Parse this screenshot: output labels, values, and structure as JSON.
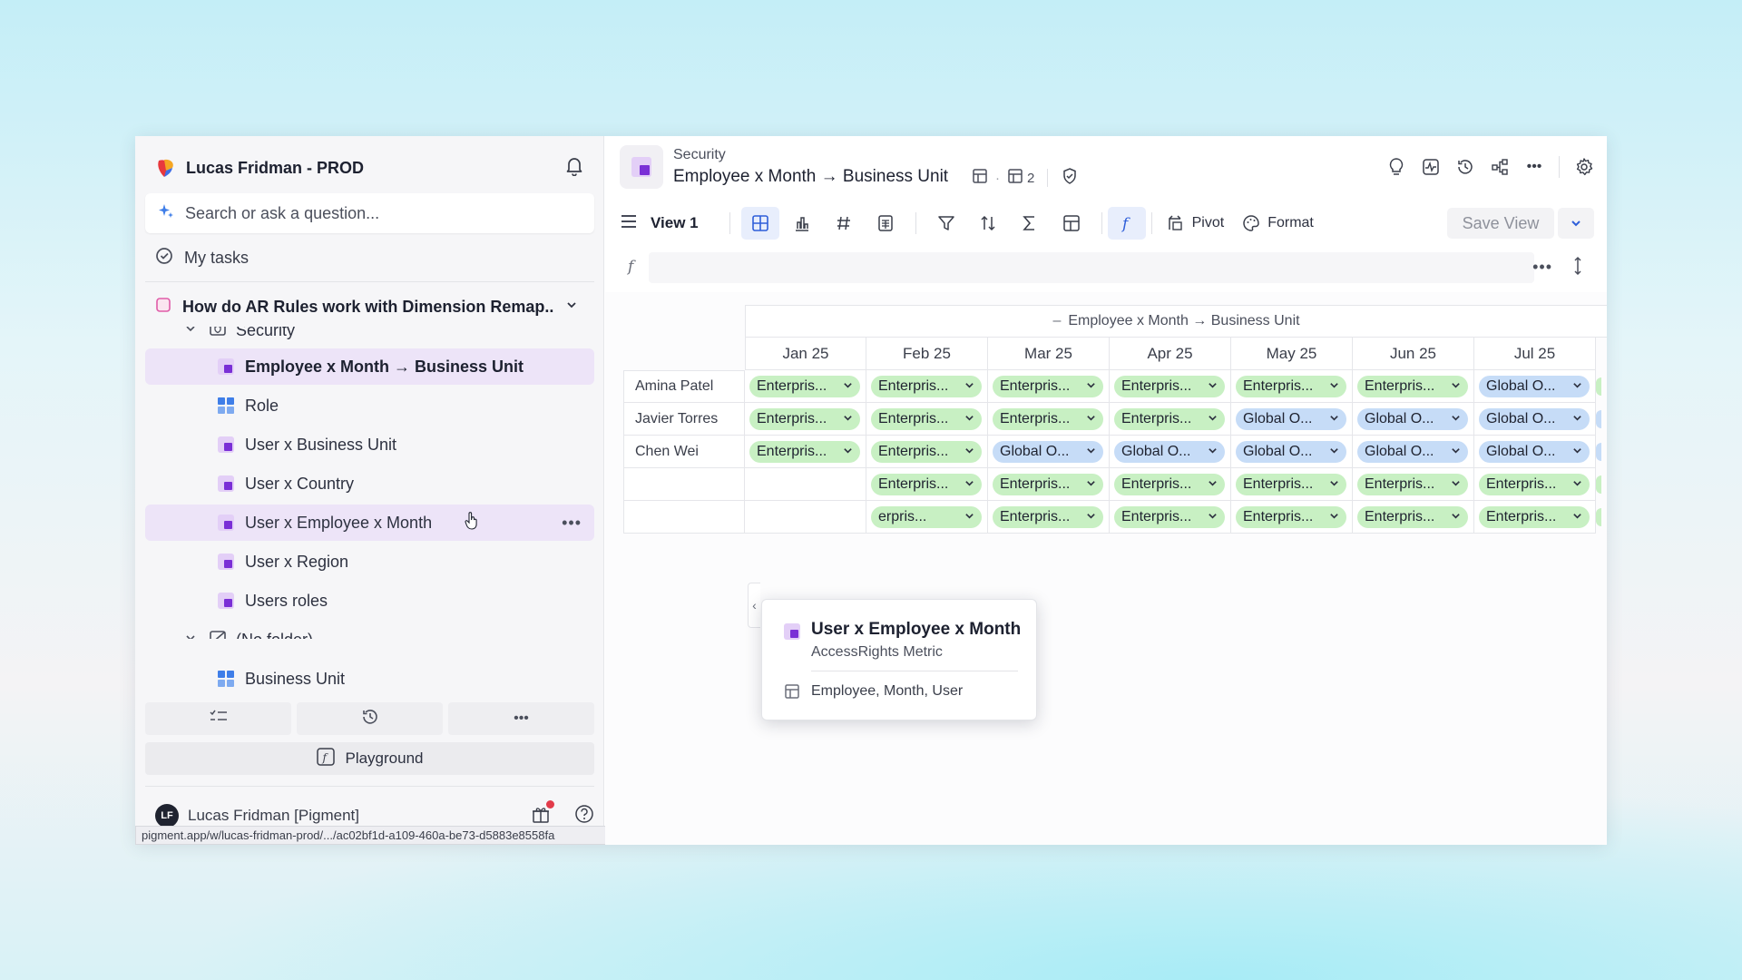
{
  "workspace": {
    "title": "Lucas Fridman - PROD"
  },
  "search": {
    "placeholder": "Search or ask a question..."
  },
  "tasks": {
    "label": "My tasks"
  },
  "app": {
    "title": "How do AR Rules work with Dimension Remap..."
  },
  "tree": {
    "items": [
      {
        "label": "Security",
        "kind": "folder"
      },
      {
        "label": "Employee x Month → Business Unit",
        "kind": "metric",
        "selected": true
      },
      {
        "label": "Role",
        "kind": "dimension"
      },
      {
        "label": "User x Business Unit",
        "kind": "metric"
      },
      {
        "label": "User x Country",
        "kind": "metric"
      },
      {
        "label": "User x Employee x Month",
        "kind": "metric",
        "hovered": true
      },
      {
        "label": "User x Region",
        "kind": "metric"
      },
      {
        "label": "Users roles",
        "kind": "metric"
      },
      {
        "label": "(No folder)",
        "kind": "folder"
      },
      {
        "label": "Business Unit",
        "kind": "dimension"
      }
    ],
    "more_label": "•••"
  },
  "bottom": {
    "playground_label": "Playground",
    "more_label": "•••"
  },
  "user": {
    "initials": "LF",
    "name": "Lucas Fridman [Pigment]"
  },
  "status_url": "pigment.app/w/lucas-fridman-prod/.../ac02bf1d-a109-460a-be73-d5883e8558fa",
  "header": {
    "breadcrumb": "Security",
    "title": "Employee x Month → Business Unit",
    "dimension_count": "2",
    "more_label": "•••"
  },
  "toolbar": {
    "view_label": "View 1",
    "pivot_label": "Pivot",
    "format_label": "Format",
    "save_label": "Save View"
  },
  "formula": {
    "more_label": "•••"
  },
  "grid": {
    "header_title": "Employee x Month → Business Unit",
    "columns": [
      "Jan 25",
      "Feb 25",
      "Mar 25",
      "Apr 25",
      "May 25",
      "Jun 25",
      "Jul 25"
    ],
    "rows": [
      {
        "name": "Amina Patel",
        "cells": [
          "Enterpris...",
          "Enterpris...",
          "Enterpris...",
          "Enterpris...",
          "Enterpris...",
          "Enterpris...",
          "Global O..."
        ]
      },
      {
        "name": "Javier Torres",
        "cells": [
          "Enterpris...",
          "Enterpris...",
          "Enterpris...",
          "Enterpris...",
          "Global O...",
          "Global O...",
          "Global O..."
        ]
      },
      {
        "name": "Chen Wei",
        "cells": [
          "Enterpris...",
          "Enterpris...",
          "Global O...",
          "Global O...",
          "Global O...",
          "Global O...",
          "Global O..."
        ]
      },
      {
        "name": "",
        "cells": [
          "",
          "Enterpris...",
          "Enterpris...",
          "Enterpris...",
          "Enterpris...",
          "Enterpris...",
          "Enterpris..."
        ]
      },
      {
        "name": "",
        "cells": [
          "",
          "erpris...",
          "Enterpris...",
          "Enterpris...",
          "Enterpris...",
          "Enterpris...",
          "Enterpris..."
        ]
      }
    ]
  },
  "tooltip": {
    "title": "User x Employee x Month",
    "subtitle": "AccessRights Metric",
    "dimensions": "Employee, Month, User"
  },
  "colors": {
    "enterprise_pill": "#c8f0c3",
    "global_pill": "#c6dcf7",
    "selected_row": "#ede4f8",
    "accent": "#2f5fd9"
  }
}
